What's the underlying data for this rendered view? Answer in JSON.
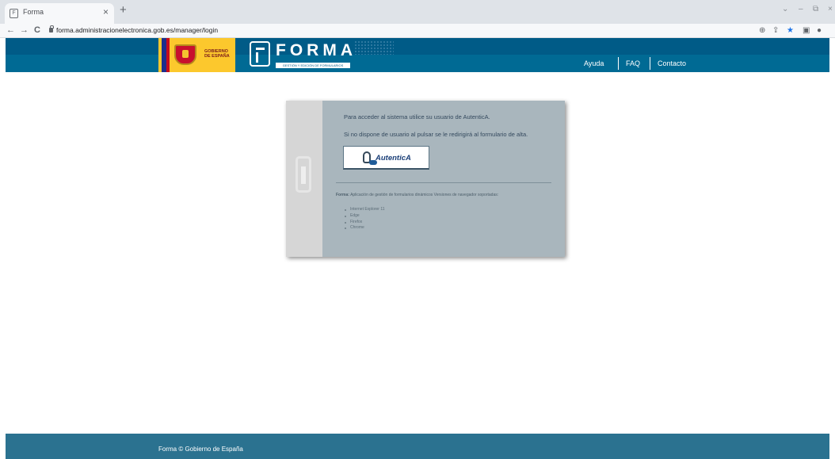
{
  "browser": {
    "tab_title": "Forma",
    "tab_close": "×",
    "new_tab": "+",
    "url": "forma.administracionelectronica.gob.es/manager/login",
    "back": "←",
    "forward": "→",
    "reload": "C"
  },
  "header": {
    "gob_logo_text": "GOBIERNO DE ESPAÑA",
    "forma_logo_text": "FORMA",
    "forma_logo_subtitle": "GESTIÓN Y EDICIÓN DE FORMULARIOS",
    "nav": [
      {
        "label": "Ayuda"
      },
      {
        "label": "FAQ"
      },
      {
        "label": "Contacto"
      }
    ]
  },
  "login": {
    "text1": "Para acceder al sistema utilice su usuario de AutenticA.",
    "text2": "Si no dispone de usuario al pulsar se le redirigirá al formulario de alta.",
    "button_label": "AutenticA",
    "info_bold": "Forma:",
    "info_text": " Aplicación de gestión de formularios dinámicos Versiones de navegador soportadas:",
    "browsers": [
      {
        "name": "Internet Explorer 11"
      },
      {
        "name": "Edge"
      },
      {
        "name": "Firefox"
      },
      {
        "name": "Chrome"
      }
    ]
  },
  "footer": {
    "text": "Forma © Gobierno de España"
  },
  "colors": {
    "header_bg": "#005b87",
    "login_bg": "#a9b6bd",
    "footer_bg": "#2b7290"
  },
  "icons": [
    "page-favicon-icon",
    "lock-icon",
    "zoom-icon",
    "share-icon",
    "star-icon",
    "sidebar-icon",
    "profile-icon",
    "autentica-hand-icon"
  ]
}
